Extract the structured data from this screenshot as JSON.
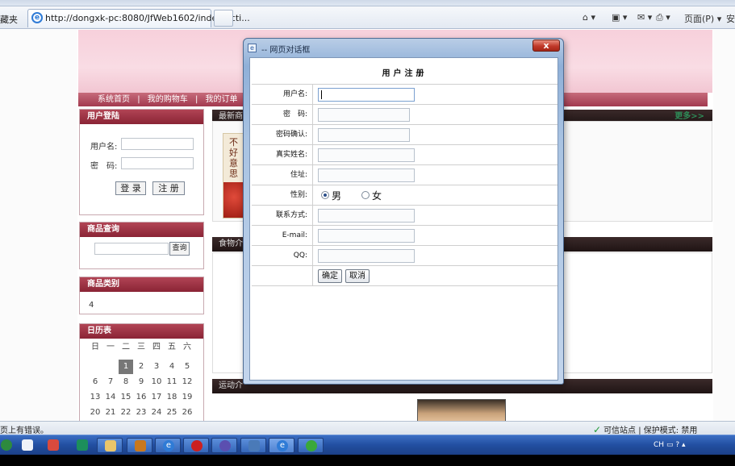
{
  "browser": {
    "favorites_label": "藏夹",
    "tab_title": "http://dongxk-pc:8080/JfWeb1602/index.acti...",
    "commands": {
      "page_menu": "页面(P) ▾",
      "safety_menu": "安"
    }
  },
  "site": {
    "nav_items": [
      "系统首页",
      "|",
      "我的购物车",
      "|",
      "我的订单",
      "|"
    ],
    "login": {
      "title": "用户登陆",
      "username_label": "用户名:",
      "password_label": "密　码:",
      "login_btn": "登 录",
      "register_btn": "注 册"
    },
    "search": {
      "title": "商品查询",
      "button": "查询"
    },
    "categories": {
      "title": "商品类别",
      "item": "4"
    },
    "calendar": {
      "title": "日历表",
      "weekdays": [
        "日",
        "一",
        "二",
        "三",
        "四",
        "五",
        "六"
      ],
      "rows": [
        [
          "",
          "",
          "",
          "1",
          "2",
          "3",
          "4",
          "5"
        ],
        [
          "6",
          "7",
          "8",
          "9",
          "10",
          "11",
          "12"
        ],
        [
          "13",
          "14",
          "15",
          "16",
          "17",
          "18",
          "19"
        ],
        [
          "20",
          "21",
          "22",
          "23",
          "24",
          "25",
          "26"
        ]
      ],
      "today": "1"
    },
    "sections": {
      "latest": "最新商",
      "more": "更多>>",
      "food": "食物介",
      "sports": "运动介"
    },
    "book_cover_text": "不好意思"
  },
  "dialog": {
    "title": "-- 网页对话框",
    "close": "x",
    "form_title": "用户注册",
    "fields": {
      "username": "用户名:",
      "password": "密　码:",
      "confirm": "密码确认:",
      "realname": "真实姓名:",
      "address": "住址:",
      "gender": "性别:",
      "phone": "联系方式:",
      "email": "E-mail:",
      "qq": "QQ:"
    },
    "gender_options": {
      "male": "男",
      "female": "女",
      "selected": "男"
    },
    "buttons": {
      "ok": "确定",
      "cancel": "取消"
    }
  },
  "status": {
    "left": "页上有错误。",
    "right": "可信站点 | 保护模式: 禁用"
  },
  "taskbar": {
    "tray_lang": "CH"
  }
}
